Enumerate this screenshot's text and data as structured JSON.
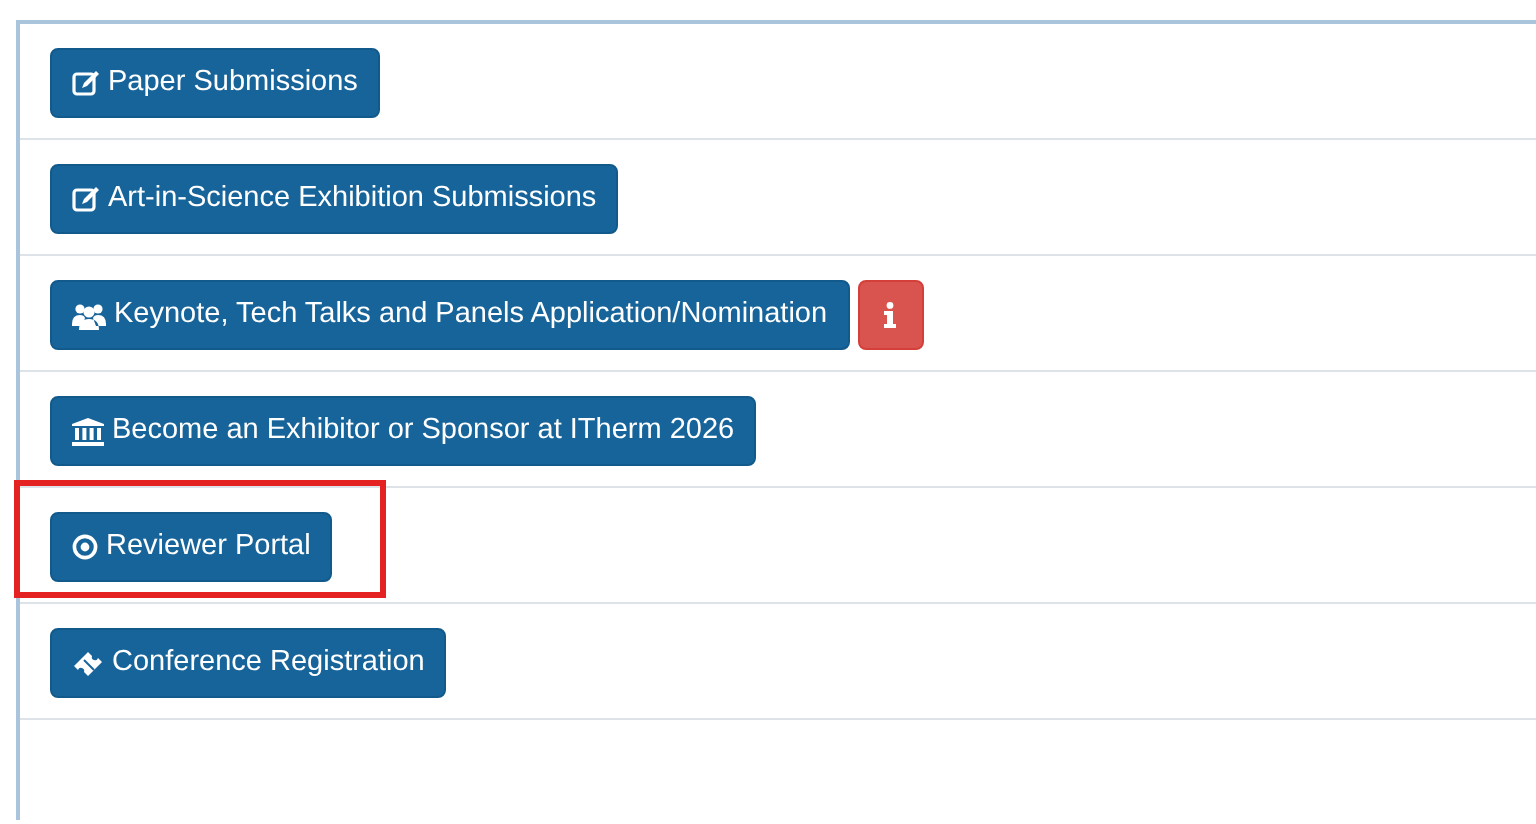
{
  "links": [
    {
      "label": "Paper Submissions",
      "info_button": false,
      "highlighted": false
    },
    {
      "label": "Art-in-Science Exhibition Submissions",
      "info_button": false,
      "highlighted": false
    },
    {
      "label": "Keynote, Tech Talks and Panels Application/Nomination",
      "info_button": true,
      "highlighted": false
    },
    {
      "label": "Become an Exhibitor or Sponsor at ITherm 2026",
      "info_button": false,
      "highlighted": false
    },
    {
      "label": "Reviewer Portal",
      "info_button": false,
      "highlighted": true
    },
    {
      "label": "Conference Registration",
      "info_button": false,
      "highlighted": false
    }
  ]
}
